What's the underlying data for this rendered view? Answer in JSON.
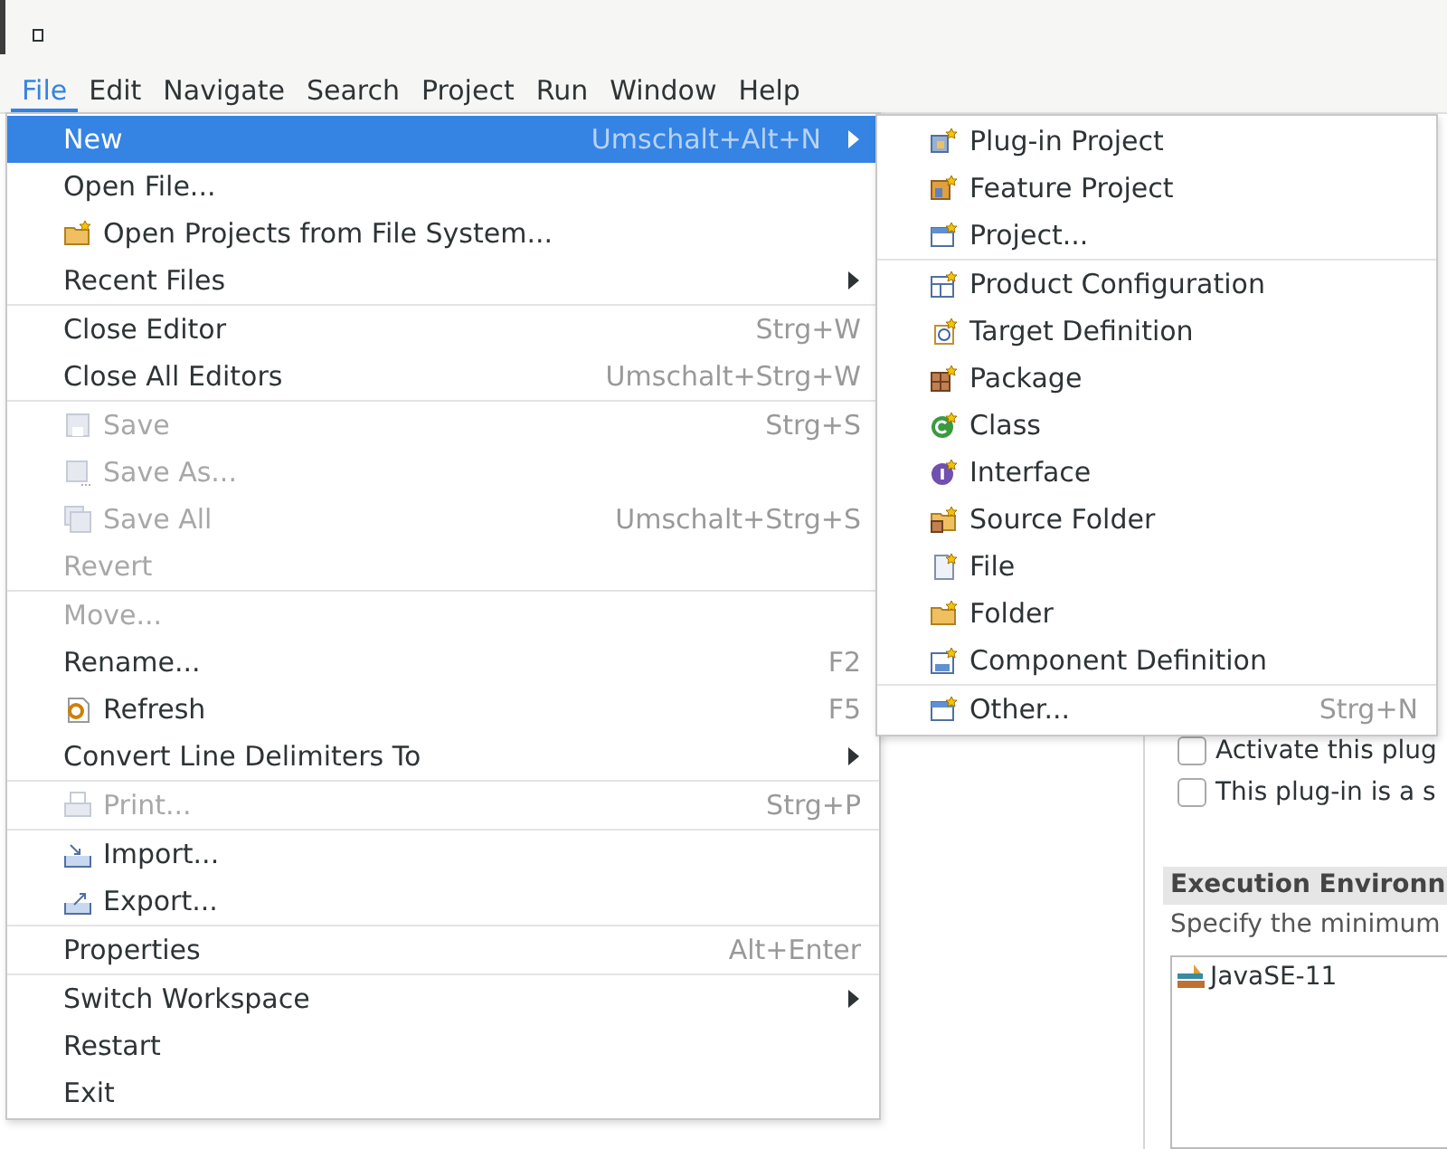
{
  "menubar": [
    {
      "label": "File",
      "selected": true
    },
    {
      "label": "Edit",
      "selected": false
    },
    {
      "label": "Navigate",
      "selected": false
    },
    {
      "label": "Search",
      "selected": false
    },
    {
      "label": "Project",
      "selected": false
    },
    {
      "label": "Run",
      "selected": false
    },
    {
      "label": "Window",
      "selected": false
    },
    {
      "label": "Help",
      "selected": false
    }
  ],
  "file_menu": [
    [
      {
        "label": "New",
        "shortcut": "Umschalt+Alt+N",
        "submenu": true,
        "selected": true,
        "disabled": false
      },
      {
        "label": "Open File...",
        "submenu": false,
        "selected": false,
        "disabled": false
      },
      {
        "label": "Open Projects from File System...",
        "submenu": false,
        "selected": false,
        "disabled": false
      },
      {
        "label": "Recent Files",
        "submenu": true,
        "selected": false,
        "disabled": false
      }
    ],
    [
      {
        "label": "Close Editor",
        "shortcut": "Strg+W",
        "submenu": false,
        "selected": false,
        "disabled": false
      },
      {
        "label": "Close All Editors",
        "shortcut": "Umschalt+Strg+W",
        "submenu": false,
        "selected": false,
        "disabled": false
      }
    ],
    [
      {
        "label": "Save",
        "shortcut": "Strg+S",
        "submenu": false,
        "selected": false,
        "disabled": true
      },
      {
        "label": "Save As...",
        "submenu": false,
        "selected": false,
        "disabled": true
      },
      {
        "label": "Save All",
        "shortcut": "Umschalt+Strg+S",
        "submenu": false,
        "selected": false,
        "disabled": true
      },
      {
        "label": "Revert",
        "submenu": false,
        "selected": false,
        "disabled": true
      }
    ],
    [
      {
        "label": "Move...",
        "submenu": false,
        "selected": false,
        "disabled": true
      },
      {
        "label": "Rename...",
        "shortcut": "F2",
        "submenu": false,
        "selected": false,
        "disabled": false
      },
      {
        "label": "Refresh",
        "shortcut": "F5",
        "submenu": false,
        "selected": false,
        "disabled": false
      },
      {
        "label": "Convert Line Delimiters To",
        "submenu": true,
        "selected": false,
        "disabled": false
      }
    ],
    [
      {
        "label": "Print...",
        "shortcut": "Strg+P",
        "submenu": false,
        "selected": false,
        "disabled": true
      }
    ],
    [
      {
        "label": "Import...",
        "submenu": false,
        "selected": false,
        "disabled": false
      },
      {
        "label": "Export...",
        "submenu": false,
        "selected": false,
        "disabled": false
      }
    ],
    [
      {
        "label": "Properties",
        "shortcut": "Alt+Enter",
        "submenu": false,
        "selected": false,
        "disabled": false
      }
    ],
    [
      {
        "label": "Switch Workspace",
        "submenu": true,
        "selected": false,
        "disabled": false
      },
      {
        "label": "Restart",
        "submenu": false,
        "selected": false,
        "disabled": false
      },
      {
        "label": "Exit",
        "submenu": false,
        "selected": false,
        "disabled": false
      }
    ]
  ],
  "new_submenu": [
    [
      {
        "label": "Plug-in Project"
      },
      {
        "label": "Feature Project"
      },
      {
        "label": "Project..."
      }
    ],
    [
      {
        "label": "Product Configuration"
      },
      {
        "label": "Target Definition"
      },
      {
        "label": "Package"
      },
      {
        "label": "Class"
      },
      {
        "label": "Interface"
      },
      {
        "label": "Source Folder"
      },
      {
        "label": "File"
      },
      {
        "label": "Folder"
      },
      {
        "label": "Component Definition"
      }
    ],
    [
      {
        "label": "Other...",
        "shortcut": "Strg+N"
      }
    ]
  ],
  "editor": {
    "checkboxes": [
      {
        "label": "Activate this plug",
        "checked": false
      },
      {
        "label": "This plug-in is a s",
        "checked": false
      }
    ],
    "section_title": "Execution Environn",
    "section_description": "Specify the minimum",
    "environments": [
      "JavaSE-11"
    ]
  }
}
